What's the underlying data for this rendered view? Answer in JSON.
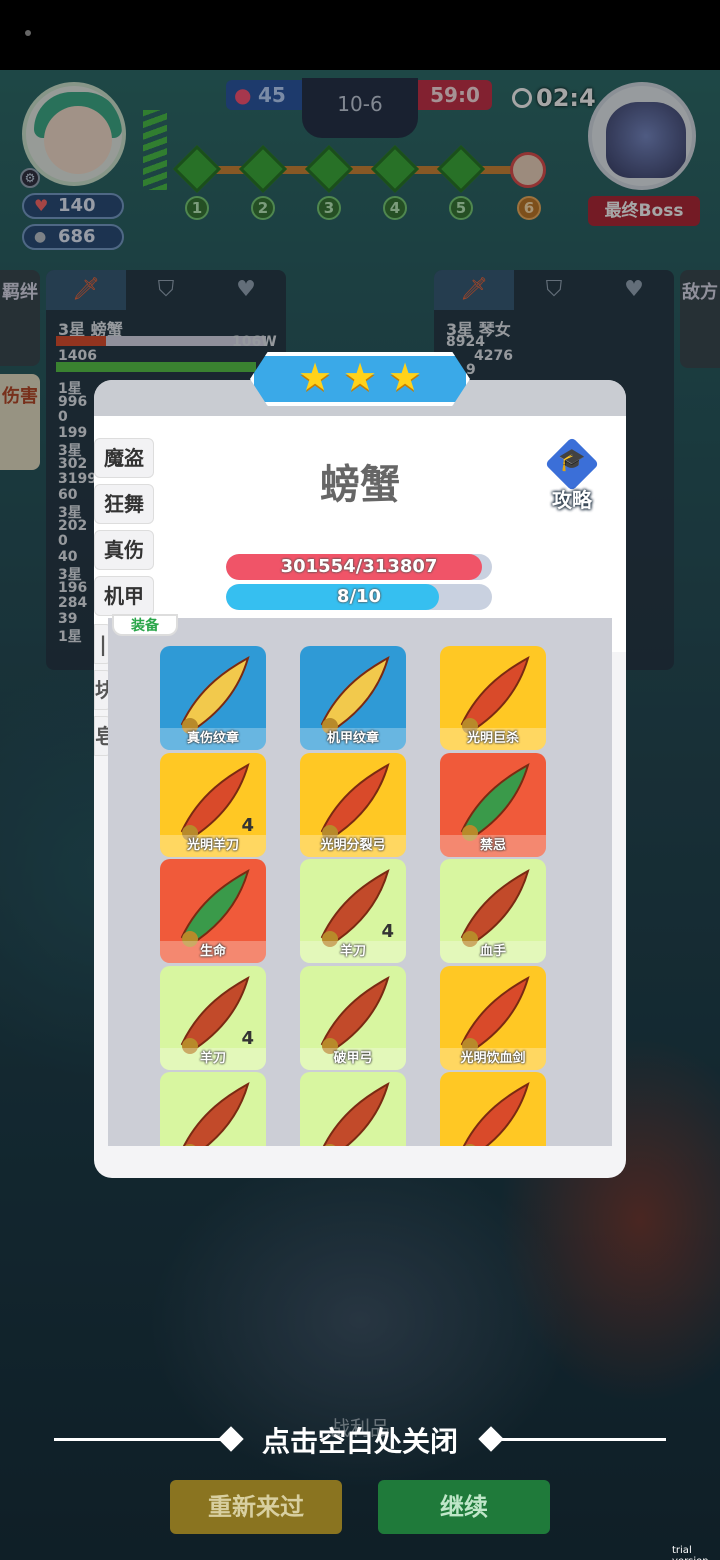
{
  "hud": {
    "hp": "140",
    "coins": "686",
    "score_blue": "45",
    "level": "10-6",
    "score_red": "59:0",
    "timer": "02:4",
    "stage_nodes": [
      "1",
      "2",
      "3",
      "4",
      "5",
      "6"
    ],
    "final_boss_label": "最终Boss"
  },
  "side": {
    "left_tab_bond": "羁绊",
    "left_tab_damage": "伤害",
    "right_tab_enemy": "敌方",
    "left_panel": {
      "title": "3星 螃蟹",
      "value1": "106W",
      "value2": "1406",
      "lines": [
        "1星",
        "996",
        "0",
        "199",
        "3星",
        "302",
        "3199",
        "60",
        "3星",
        "202",
        "0",
        "40",
        "3星",
        "196",
        "284",
        "39",
        "1星"
      ]
    },
    "right_panel": {
      "title": "3星 琴女",
      "lines": [
        "8924",
        "4276",
        "9"
      ]
    }
  },
  "modal": {
    "stars": 3,
    "hero_name": "螃蟹",
    "guide_label": "攻略",
    "class_tabs": [
      "魔盗",
      "狂舞",
      "真伤",
      "机甲"
    ],
    "class_tabs_partial": [
      "|",
      "块",
      "皂"
    ],
    "hp_text": "301554/313807",
    "hp_ratio": 0.961,
    "mana_text": "8/10",
    "mana_ratio": 0.8,
    "equip_tag": "装备",
    "items": [
      {
        "name": "真伤纹章",
        "bg": "blue",
        "level": ""
      },
      {
        "name": "机甲纹章",
        "bg": "blue",
        "level": ""
      },
      {
        "name": "光明巨杀",
        "bg": "gold",
        "level": ""
      },
      {
        "name": "光明羊刀",
        "bg": "gold",
        "level": "4"
      },
      {
        "name": "光明分裂弓",
        "bg": "gold",
        "level": ""
      },
      {
        "name": "禁忌",
        "bg": "red",
        "level": ""
      },
      {
        "name": "生命",
        "bg": "red",
        "level": ""
      },
      {
        "name": "羊刀",
        "bg": "green",
        "level": "4"
      },
      {
        "name": "血手",
        "bg": "green",
        "level": ""
      },
      {
        "name": "羊刀",
        "bg": "green",
        "level": "4"
      },
      {
        "name": "破甲弓",
        "bg": "green",
        "level": ""
      },
      {
        "name": "光明饮血剑",
        "bg": "gold",
        "level": ""
      },
      {
        "name": "",
        "bg": "green",
        "level": ""
      },
      {
        "name": "",
        "bg": "green",
        "level": ""
      },
      {
        "name": "",
        "bg": "gold",
        "level": ""
      }
    ]
  },
  "footer": {
    "close_hint": "点击空白处关闭",
    "ghost_text": "战利品",
    "retry_label": "重新来过",
    "continue_label": "继续",
    "watermark": "trial version"
  }
}
